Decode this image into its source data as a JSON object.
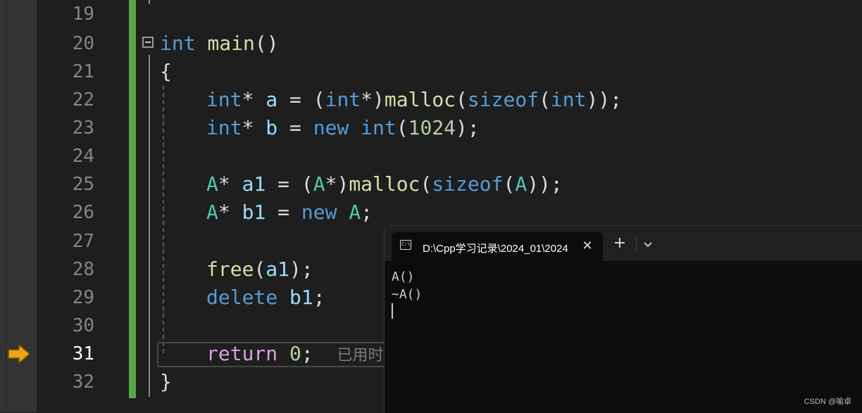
{
  "editor": {
    "line_numbers": [
      "19",
      "20",
      "21",
      "22",
      "23",
      "24",
      "25",
      "26",
      "27",
      "28",
      "29",
      "30",
      "31",
      "32"
    ],
    "current_line": "31",
    "code": {
      "l20": {
        "kw": "int",
        "fn": "main",
        "p": "()"
      },
      "l21": {
        "brace": "{"
      },
      "l22": {
        "t1": "int",
        "s1": "* ",
        "v": "a",
        "s2": " = (",
        "t2": "int",
        "s3": "*)",
        "f1": "malloc",
        "s4": "(",
        "k": "sizeof",
        "s5": "(",
        "t3": "int",
        "s6": "));"
      },
      "l23": {
        "t1": "int",
        "s1": "* ",
        "v": "b",
        "s2": " = ",
        "k": "new",
        "s3": " ",
        "t2": "int",
        "s4": "(",
        "n": "1024",
        "s5": ");"
      },
      "l25": {
        "t1": "A",
        "s1": "* ",
        "v": "a1",
        "s2": " = (",
        "t2": "A",
        "s3": "*)",
        "f1": "malloc",
        "s4": "(",
        "k": "sizeof",
        "s5": "(",
        "t3": "A",
        "s6": "));"
      },
      "l26": {
        "t1": "A",
        "s1": "* ",
        "v": "b1",
        "s2": " = ",
        "k": "new",
        "s3": " ",
        "t2": "A",
        "s4": ";"
      },
      "l28": {
        "f": "free",
        "s1": "(",
        "v": "a1",
        "s2": ");"
      },
      "l29": {
        "k": "delete",
        "s1": " ",
        "v": "b1",
        "s2": ";"
      },
      "l31": {
        "k": "return",
        "s1": " ",
        "n": "0",
        "s2": ";",
        "hint": "已用时间"
      },
      "l32": {
        "brace": "}"
      }
    }
  },
  "terminal": {
    "tab_title": "D:\\Cpp学习记录\\2024_01\\2024",
    "icon_text": "C:\\",
    "close_glyph": "✕",
    "new_tab_glyph": "+",
    "output": [
      "A()",
      "~A()"
    ]
  },
  "watermark": "CSDN @喻卓",
  "colors": {
    "background": "#1e1e1e",
    "change_bar": "#57a64a",
    "breakpoint_arrow": "#e8a317",
    "terminal_bg": "#0c0c0c"
  }
}
